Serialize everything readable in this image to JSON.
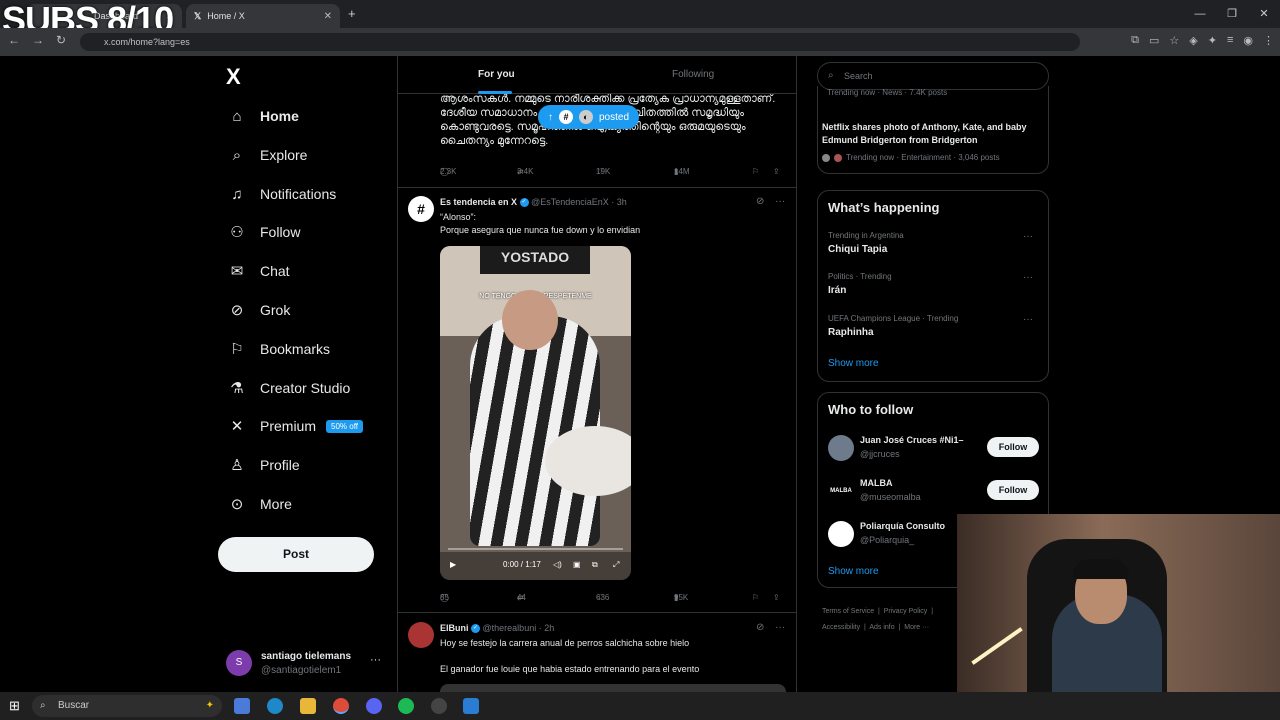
{
  "overlay_text": "SUBS 8/10",
  "browser": {
    "tab1_title": "Dashboard",
    "tab2_title": "Home / X",
    "url": "x.com/home?lang=es",
    "tab_close": "✕",
    "new_tab": "+"
  },
  "nav": {
    "logo": "X",
    "items": [
      {
        "label": "Home",
        "icon": "home-icon"
      },
      {
        "label": "Explore",
        "icon": "search-icon"
      },
      {
        "label": "Notifications",
        "icon": "bell-icon"
      },
      {
        "label": "Follow",
        "icon": "person-add-icon"
      },
      {
        "label": "Chat",
        "icon": "mail-icon"
      },
      {
        "label": "Grok",
        "icon": "grok-icon"
      },
      {
        "label": "Bookmarks",
        "icon": "bookmark-icon"
      },
      {
        "label": "Creator Studio",
        "icon": "flask-icon"
      },
      {
        "label": "Premium",
        "icon": "x-icon"
      },
      {
        "label": "Profile",
        "icon": "person-icon"
      },
      {
        "label": "More",
        "icon": "more-circle-icon"
      }
    ],
    "premium_badge": "50% off",
    "post_button": "Post"
  },
  "account": {
    "initial": "S",
    "name": "santiago tielemans",
    "handle": "@santiagotielem1",
    "more": "···"
  },
  "feed": {
    "tabs": [
      "For you",
      "Following"
    ],
    "pill_label": "posted",
    "prev_tweet_text": "ആശംസകൾ. നമ്മുടെ നാരീശക്തിക്ക പ്രത്യേക പ്രാധാന്യമുള്ളതാണ്. ദേശീയ സമാധാനം എല്ലാവരുടെയും ജീവിതത്തിൽ സമൃദ്ധിയും കൊണ്ടുവരട്ടെ. സമൂഹത്തിൽ ഐക്യത്തിന്റെയും ഒരുമയുടെയും ചൈതന്യം മുന്നേറട്ടെ.",
    "prev_tweet_stats": {
      "replies": "2.3K",
      "reposts": "3.4K",
      "likes": "19K",
      "views": "14M"
    },
    "tweet1": {
      "name": "Es tendencia en X",
      "handle": "@EsTendenciaEnX",
      "time": "· 3h",
      "line1": "“Alonso”:",
      "line2": "Porque asegura que nunca fue down y lo envidian",
      "video_sign": "YOSTADO",
      "video_caption": "NO TENGO DAWN, RESPÉTENME",
      "video_time": "0:00 / 1:17",
      "stats": {
        "replies": "85",
        "reposts": "44",
        "likes": "636",
        "views": "95K"
      }
    },
    "tweet2": {
      "name": "ElBuni",
      "handle": "@therealbuni",
      "time": "· 2h",
      "line1": "Hoy se festejo la carrera anual de perros salchicha sobre hielo",
      "line2": "El ganador fue louie que habia estado entrenando para el evento"
    }
  },
  "right": {
    "search_placeholder": "Search",
    "news_top_meta": "Trending now · News · 7.4K posts",
    "news_title": "Netflix shares photo of Anthony, Kate, and baby Edmund Bridgerton from Bridgerton",
    "news_meta": "Trending now · Entertainment · 3,046 posts",
    "happening_title": "What’s happening",
    "trends": [
      {
        "meta": "Trending in Argentina",
        "name": "Chiqui Tapia"
      },
      {
        "meta": "Politics · Trending",
        "name": "Irán"
      },
      {
        "meta": "UEFA Champions League · Trending",
        "name": "Raphinha"
      }
    ],
    "show_more": "Show more",
    "wtf_title": "Who to follow",
    "wtf": [
      {
        "name": "Juan José Cruces #Ni1–",
        "handle": "@jjcruces",
        "button": "Follow"
      },
      {
        "name": "MALBA",
        "handle": "@museomalba",
        "button": "Follow"
      },
      {
        "name": "Poliarquía Consulto",
        "handle": "@Poliarquia_",
        "button": ""
      }
    ],
    "footer": [
      "Terms of Service",
      "Privacy Policy",
      "Accessibility",
      "Ads info",
      "More ···"
    ]
  },
  "taskbar": {
    "search_label": "Buscar"
  },
  "colors": {
    "accent": "#1d9bf0",
    "background": "#000000",
    "border": "#2f3336"
  }
}
